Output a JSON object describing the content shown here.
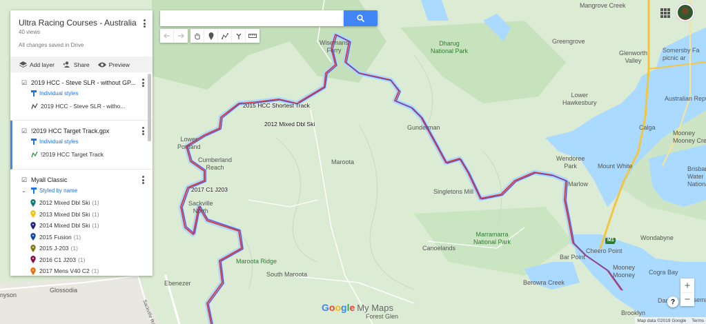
{
  "panel": {
    "title": "Ultra Racing Courses - Australia",
    "views": "40 views",
    "save_status": "All changes saved in Drive",
    "toolbar": {
      "add_layer": "Add layer",
      "share": "Share",
      "preview": "Preview"
    },
    "layers": [
      {
        "name": "2019 HCC - Steve SLR - without GP...",
        "style": "Individual styles",
        "items": [
          "2019 HCC - Steve SLR - witho..."
        ]
      },
      {
        "name": "!2019 HCC Target Track.gpx",
        "style": "Individual styles",
        "items": [
          "!2019 HCC Target Track"
        ]
      },
      {
        "name": "Myall Classic",
        "style": "Styled by name",
        "pins": [
          {
            "label": "2012 Mixed Dbl Ski",
            "count": "(1)",
            "color": "#0b7a75"
          },
          {
            "label": "2013 Mixed Dbl Ski",
            "count": "(1)",
            "color": "#f4c20d"
          },
          {
            "label": "2014 Mixed Dbl Ski",
            "count": "(1)",
            "color": "#1a237e"
          },
          {
            "label": "2015 Fusion",
            "count": "(1)",
            "color": "#0d47a1"
          },
          {
            "label": "2015 J-203",
            "count": "(1)",
            "color": "#827717"
          },
          {
            "label": "2016 C1 J203",
            "count": "(1)",
            "color": "#880e4f"
          },
          {
            "label": "2017 Mens V40 C2",
            "count": "(1)",
            "color": "#ef6c00"
          }
        ]
      }
    ]
  },
  "search": {
    "value": "",
    "placeholder": ""
  },
  "map_labels": {
    "parks": [
      "Dharug\nNational Park",
      "Marramarra\nNational Park"
    ],
    "towns": [
      "Mangrove\nCreek",
      "Greengrove",
      "Glenworth\nValley",
      "Somersby Fa\npicnic ar",
      "Lower\nHawkesbury",
      "Australian Reptil",
      "Wisemans\nFerry",
      "Gunderman",
      "Calga",
      "Mooney\nMooney Cre",
      "Wendoree\nPark",
      "Mount White",
      "Brisban\nWater\nNational",
      "Lower\nPortland",
      "Cumberland\nReach",
      "Maroota",
      "Singletons Mill",
      "Marlow",
      "Sackville\nNorth",
      "Canoelands",
      "Wondabyne",
      "Cheero Point",
      "Bar Point",
      "Mooney\nMooney",
      "Cogra Bay",
      "Maroota Ridge",
      "South Maroota",
      "Ebenezer",
      "Berowra Creek",
      "Glossodia",
      "Forest Glen",
      "Brooklyn",
      "Dangar Is",
      "Wiseman",
      "nyson",
      "Sackville Rd"
    ],
    "tracks": [
      "2015 HCC Shortest Track",
      "2012 Mixed Dbl Ski",
      "2017 C1 J203"
    ],
    "road": "M1"
  },
  "footer": {
    "google": "Google",
    "my_maps": "My Maps",
    "map_data": "Map data ©2019 Google",
    "terms": "Terms",
    "zoom_in": "+",
    "zoom_out": "−",
    "help": "?"
  },
  "colors": {
    "accent": "#4285f4",
    "track_blue": "#5b4bd0",
    "track_red": "#d8403a",
    "water": "#aadaff"
  }
}
